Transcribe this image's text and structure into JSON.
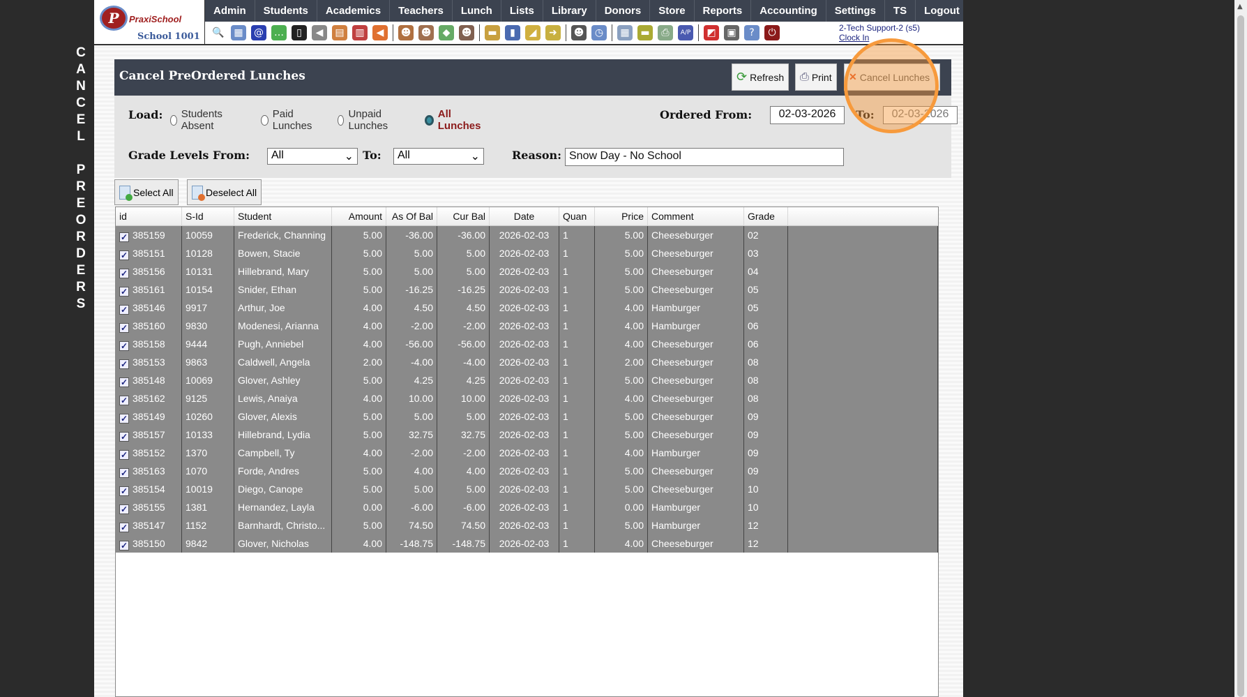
{
  "sidebar_vertical_title": [
    "C",
    "A",
    "N",
    "C",
    "E",
    "L",
    "",
    "P",
    "R",
    "E",
    "O",
    "R",
    "D",
    "E",
    "R",
    "S"
  ],
  "logo": {
    "brand": "PraxiSchool",
    "school": "School 1001"
  },
  "nav": [
    "Admin",
    "Students",
    "Academics",
    "Teachers",
    "Lunch",
    "Lists",
    "Library",
    "Donors",
    "Store",
    "Reports",
    "Accounting",
    "Settings",
    "TS",
    "Logout"
  ],
  "toolbar_icons": [
    "search",
    "calendar-grid",
    "email-at",
    "chat-add",
    "mobile-phone",
    "speaker",
    "schedule",
    "calendar",
    "megaphone",
    "|",
    "user-add",
    "user",
    "money",
    "users",
    "|",
    "hamburger",
    "book",
    "tag",
    "export",
    "|",
    "teacher",
    "alarm-clock",
    "|",
    "calculator",
    "card",
    "printer-money",
    "ap",
    "|",
    "pdf",
    "cash-register",
    "help",
    "power"
  ],
  "user": {
    "name": "2-Tech Support-2 (s5)",
    "clock_in": "Clock In"
  },
  "panel": {
    "title": "Cancel PreOrdered Lunches",
    "refresh": "Refresh",
    "print": "Print",
    "cancel": "Cancel Lunches",
    "load_label": "Load:",
    "load_options": [
      "Students Absent",
      "Paid Lunches",
      "Unpaid Lunches",
      "All Lunches"
    ],
    "load_selected": "All Lunches",
    "ordered_from_label": "Ordered From:",
    "ordered_from": "02-03-2026",
    "to_label": "To:",
    "ordered_to": "02-03-2026",
    "grade_from_label": "Grade Levels From:",
    "grade_from": "All",
    "grade_to_label": "To:",
    "grade_to": "All",
    "reason_label": "Reason:",
    "reason": "Snow Day - No School"
  },
  "select_all": "Select All",
  "deselect_all": "Deselect All",
  "columns": [
    "id",
    "S-Id",
    "Student",
    "Amount",
    "As Of Bal",
    "Cur Bal",
    "Date",
    "Quan",
    "Price",
    "Comment",
    "Grade"
  ],
  "rows": [
    [
      "385159",
      "10059",
      "Frederick, Channing",
      "5.00",
      "-36.00",
      "-36.00",
      "2026-02-03",
      "1",
      "5.00",
      "Cheeseburger",
      "02"
    ],
    [
      "385151",
      "10128",
      "Bowen, Stacie",
      "5.00",
      "5.00",
      "5.00",
      "2026-02-03",
      "1",
      "5.00",
      "Cheeseburger",
      "03"
    ],
    [
      "385156",
      "10131",
      "Hillebrand, Mary",
      "5.00",
      "5.00",
      "5.00",
      "2026-02-03",
      "1",
      "5.00",
      "Cheeseburger",
      "04"
    ],
    [
      "385161",
      "10154",
      "Snider, Ethan",
      "5.00",
      "-16.25",
      "-16.25",
      "2026-02-03",
      "1",
      "5.00",
      "Cheeseburger",
      "05"
    ],
    [
      "385146",
      "9917",
      "Arthur, Joe",
      "4.00",
      "4.50",
      "4.50",
      "2026-02-03",
      "1",
      "4.00",
      "Hamburger",
      "05"
    ],
    [
      "385160",
      "9830",
      "Modenesi, Arianna",
      "4.00",
      "-2.00",
      "-2.00",
      "2026-02-03",
      "1",
      "4.00",
      "Hamburger",
      "06"
    ],
    [
      "385158",
      "9444",
      "Pugh, Anniebel",
      "4.00",
      "-56.00",
      "-56.00",
      "2026-02-03",
      "1",
      "4.00",
      "Cheeseburger",
      "06"
    ],
    [
      "385153",
      "9863",
      "Caldwell, Angela",
      "2.00",
      "-4.00",
      "-4.00",
      "2026-02-03",
      "1",
      "2.00",
      "Cheeseburger",
      "08"
    ],
    [
      "385148",
      "10069",
      "Glover, Ashley",
      "5.00",
      "4.25",
      "4.25",
      "2026-02-03",
      "1",
      "5.00",
      "Cheeseburger",
      "08"
    ],
    [
      "385162",
      "9125",
      "Lewis, Anaiya",
      "4.00",
      "10.00",
      "10.00",
      "2026-02-03",
      "1",
      "4.00",
      "Cheeseburger",
      "08"
    ],
    [
      "385149",
      "10260",
      "Glover, Alexis",
      "5.00",
      "5.00",
      "5.00",
      "2026-02-03",
      "1",
      "5.00",
      "Cheeseburger",
      "09"
    ],
    [
      "385157",
      "10133",
      "Hillebrand, Lydia",
      "5.00",
      "32.75",
      "32.75",
      "2026-02-03",
      "1",
      "5.00",
      "Cheeseburger",
      "09"
    ],
    [
      "385152",
      "1370",
      "Campbell, Ty",
      "4.00",
      "-2.00",
      "-2.00",
      "2026-02-03",
      "1",
      "4.00",
      "Hamburger",
      "09"
    ],
    [
      "385163",
      "1070",
      "Forde, Andres",
      "5.00",
      "4.00",
      "4.00",
      "2026-02-03",
      "1",
      "5.00",
      "Cheeseburger",
      "09"
    ],
    [
      "385154",
      "10019",
      "Diego, Canope",
      "5.00",
      "5.00",
      "5.00",
      "2026-02-03",
      "1",
      "5.00",
      "Cheeseburger",
      "10"
    ],
    [
      "385155",
      "1381",
      "Hernandez, Layla",
      "0.00",
      "-6.00",
      "-6.00",
      "2026-02-03",
      "1",
      "0.00",
      "Hamburger",
      "10"
    ],
    [
      "385147",
      "1152",
      "Barnhardt, Christo...",
      "5.00",
      "74.50",
      "74.50",
      "2026-02-03",
      "1",
      "5.00",
      "Hamburger",
      "12"
    ],
    [
      "385150",
      "9842",
      "Glover, Nicholas",
      "4.00",
      "-148.75",
      "-148.75",
      "2026-02-03",
      "1",
      "4.00",
      "Cheeseburger",
      "12"
    ]
  ]
}
